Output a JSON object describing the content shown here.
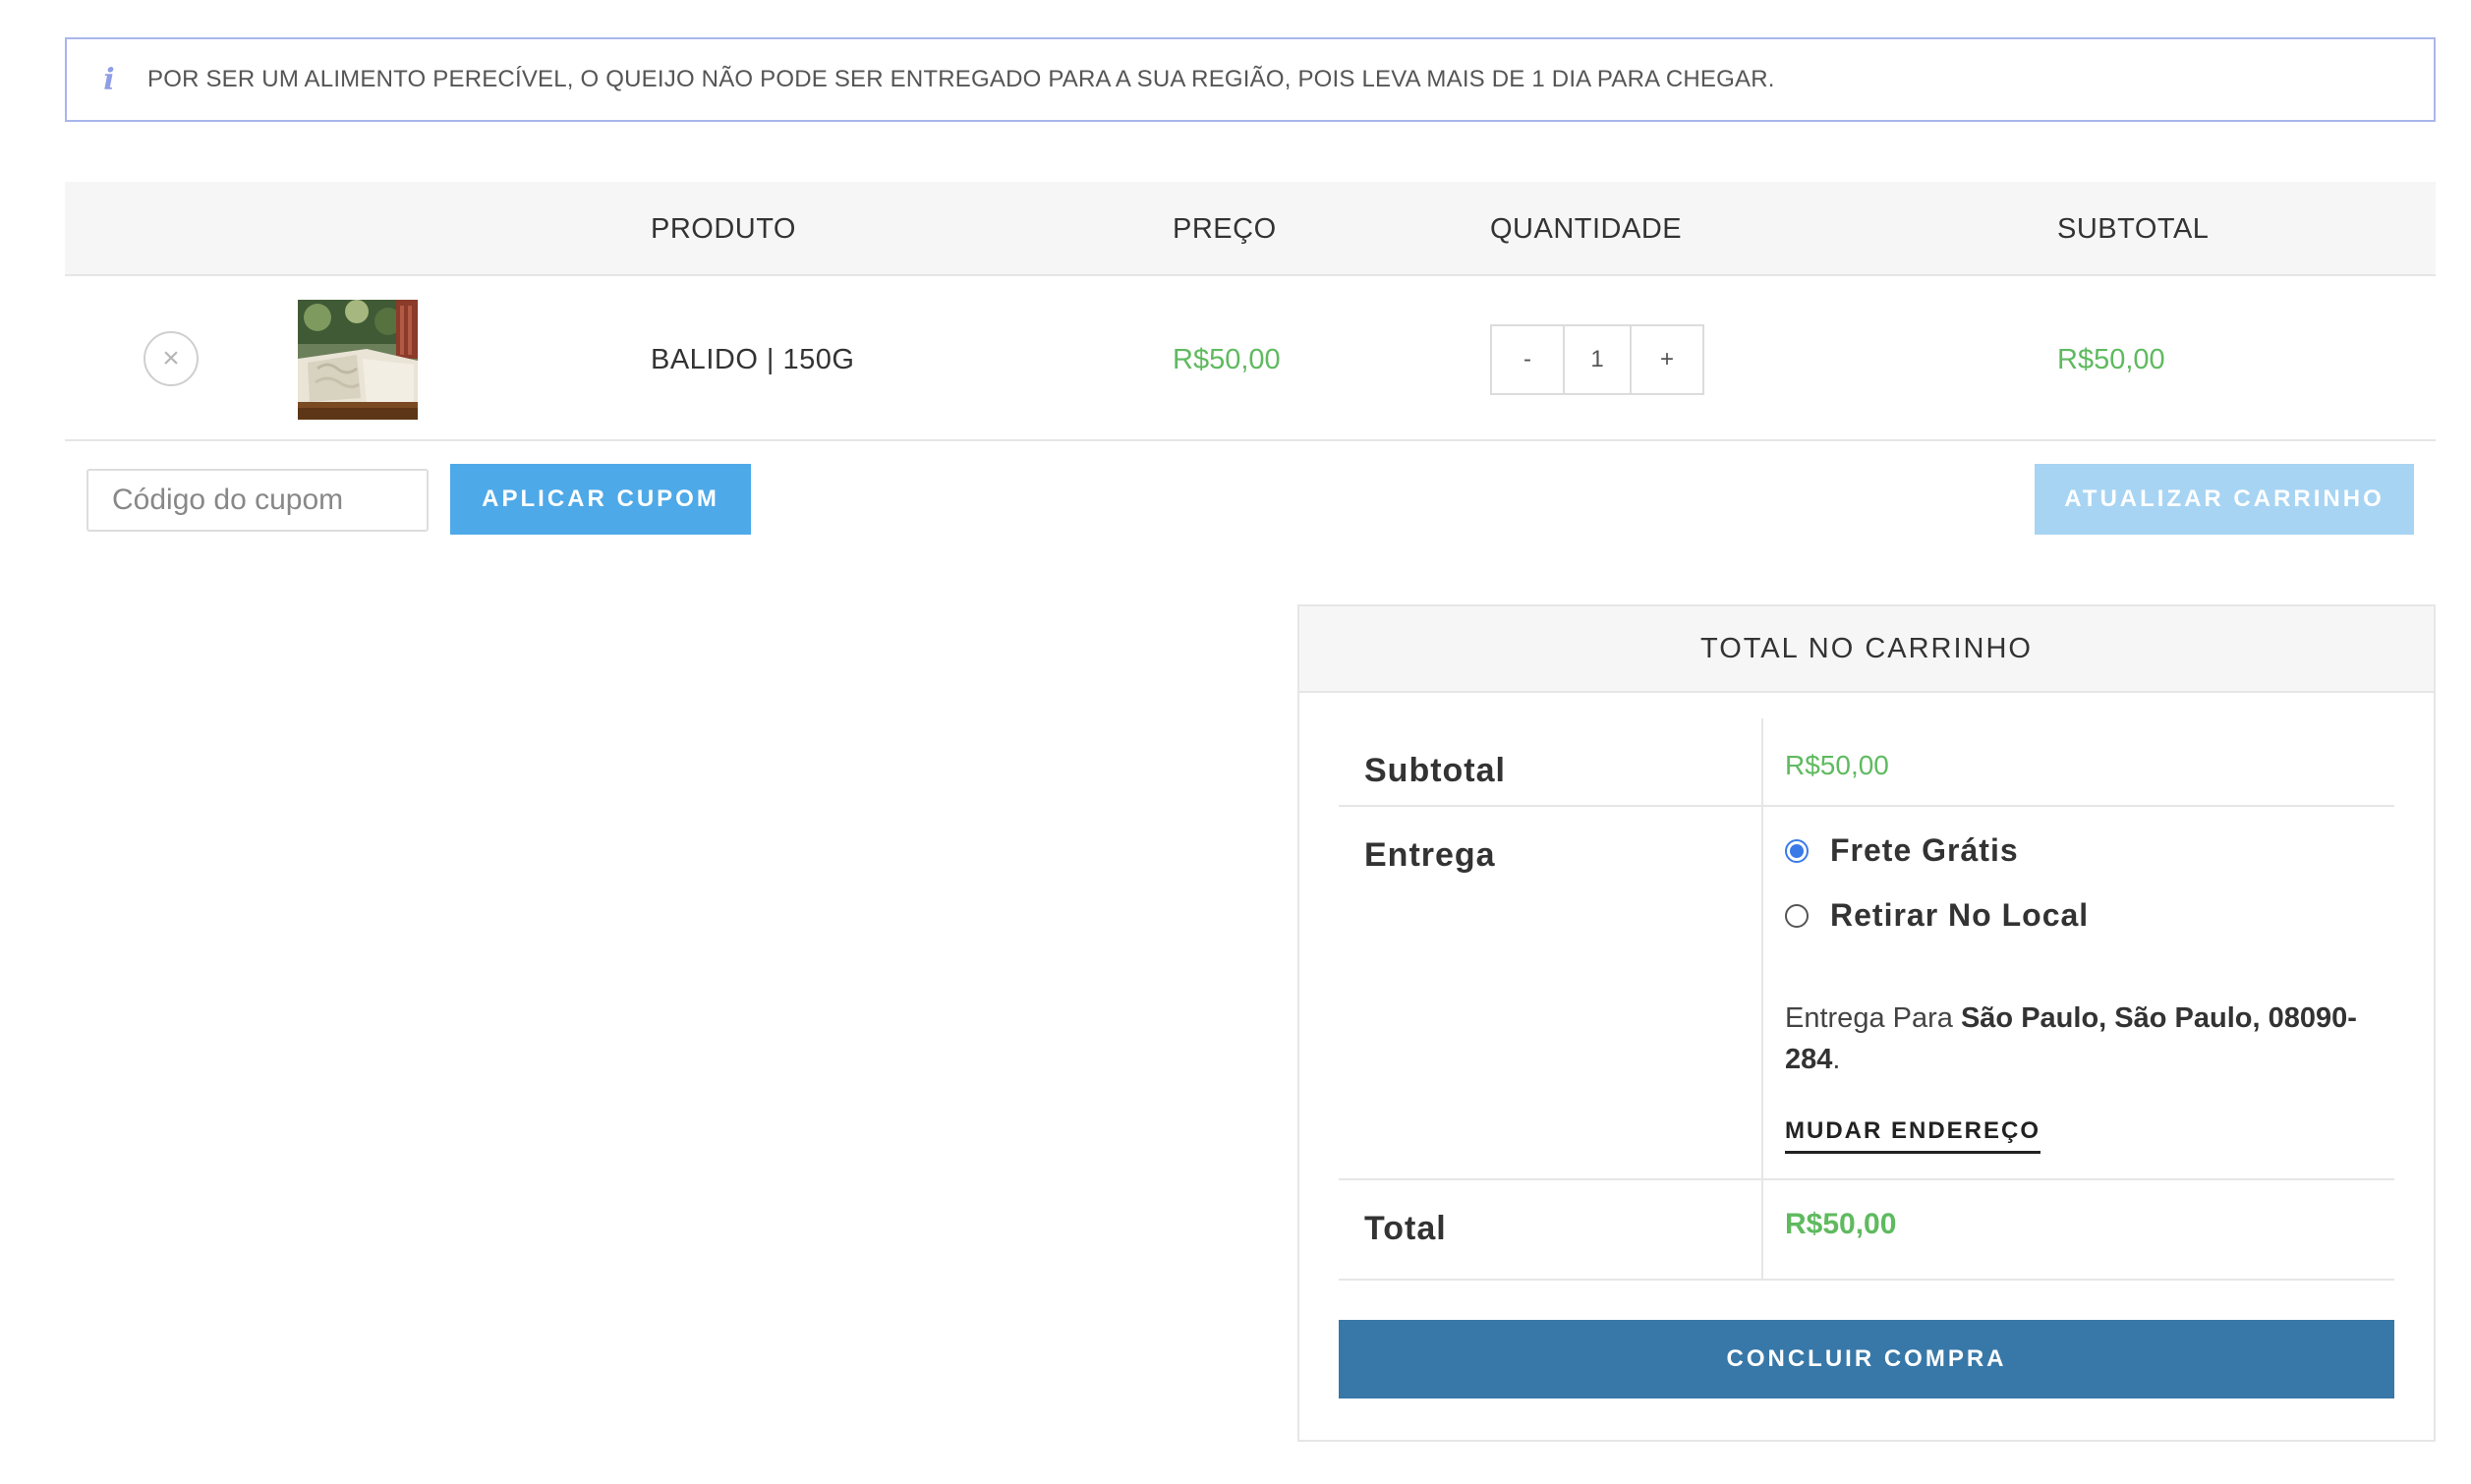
{
  "notice": {
    "icon": "info-icon",
    "text": "POR SER UM ALIMENTO PERECÍVEL, O QUEIJO NÃO PODE SER ENTREGADO PARA A SUA REGIÃO, POIS LEVA MAIS DE 1 DIA PARA CHEGAR."
  },
  "cart_table": {
    "headers": {
      "product": "PRODUTO",
      "price": "PREÇO",
      "quantity": "QUANTIDADE",
      "subtotal": "SUBTOTAL"
    },
    "items": [
      {
        "product": "BALIDO | 150G",
        "price": "R$50,00",
        "quantity": "1",
        "minus": "-",
        "plus": "+",
        "subtotal": "R$50,00",
        "remove_icon": "×"
      }
    ]
  },
  "coupon": {
    "placeholder": "Código do cupom",
    "apply_label": "APLICAR CUPOM",
    "update_label": "ATUALIZAR CARRINHO"
  },
  "totals": {
    "title": "TOTAL NO CARRINHO",
    "subtotal_label": "Subtotal",
    "subtotal_value": "R$50,00",
    "shipping_label": "Entrega",
    "shipping_options": [
      "Frete Grátis",
      "Retirar No Local"
    ],
    "selected_option": "Frete Grátis",
    "destination_prefix": "Entrega Para",
    "destination_address": "São Paulo, São Paulo, 08090-284",
    "destination_suffix": ".",
    "change_address": "MUDAR ENDEREÇO",
    "total_label": "Total",
    "total_value": "R$50,00",
    "checkout_label": "CONCLUIR COMPRA"
  },
  "colors": {
    "accent_green": "#5fba5f",
    "apply_button": "#4ea9e8",
    "update_button": "#a7d4f3",
    "checkout_button": "#3878a8",
    "radio_selected": "#3a7ae8",
    "notice_border": "#a9b6ec"
  }
}
